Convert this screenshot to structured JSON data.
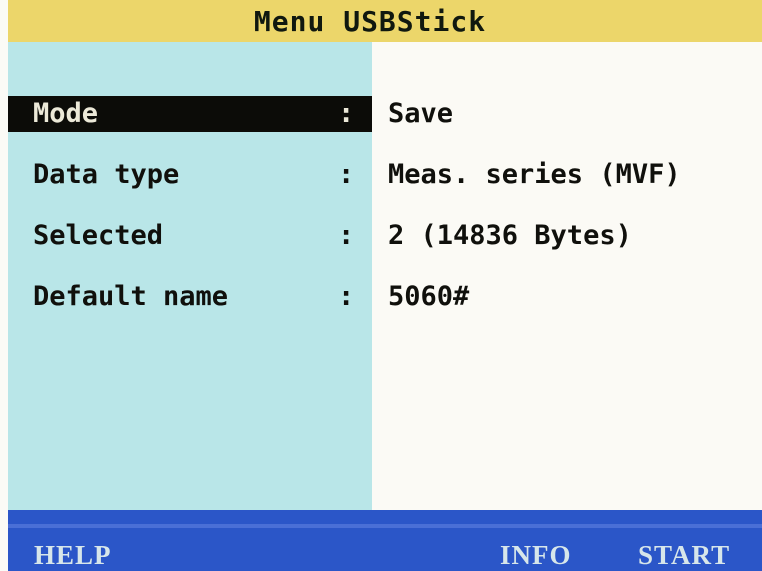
{
  "title": "Menu USBStick",
  "menu": {
    "rows": [
      {
        "label": "Mode",
        "separator": ":",
        "value": "Save",
        "selected": true
      },
      {
        "label": "Data type",
        "separator": ":",
        "value": "Meas. series (MVF)",
        "selected": false
      },
      {
        "label": "Selected",
        "separator": ":",
        "value": "2 (14836 Bytes)",
        "selected": false
      },
      {
        "label": "Default name",
        "separator": ":",
        "value": "5060#",
        "selected": false
      }
    ]
  },
  "softkeys": {
    "help": "HELP",
    "info": "INFO",
    "start": "START"
  },
  "colors": {
    "title_bar": "#ecd66a",
    "label_panel": "#b9e6e8",
    "value_panel": "#fbfaf5",
    "selection": "#0c0c08",
    "softkey_bar": "#2b56c8",
    "softkey_text": "#d7e6ea"
  }
}
